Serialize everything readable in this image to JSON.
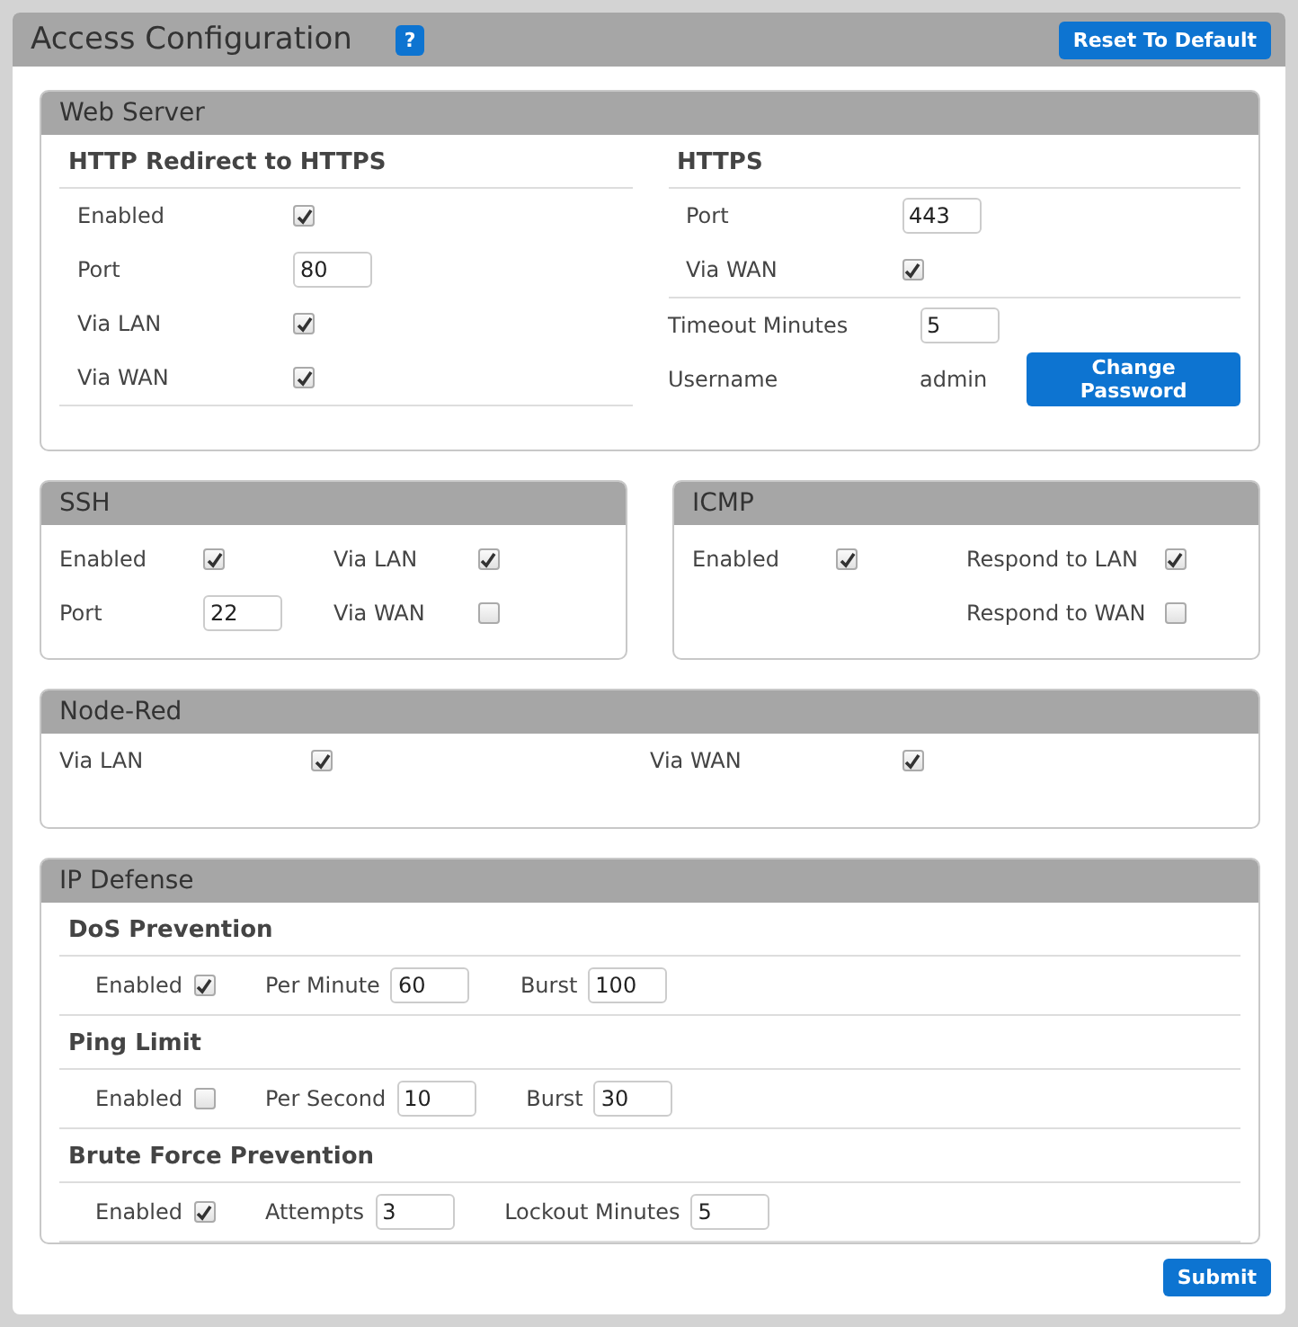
{
  "title": "Access Configuration",
  "help_button": "?",
  "reset_button": "Reset To Default",
  "web_server": {
    "title": "Web Server",
    "redirect": {
      "heading": "HTTP Redirect to HTTPS",
      "fields": [
        {
          "label": "Enabled",
          "kind": "checkbox",
          "checked": true
        },
        {
          "label": "Port",
          "kind": "input",
          "value": "80"
        },
        {
          "label": "Via LAN",
          "kind": "checkbox",
          "checked": true
        },
        {
          "label": "Via WAN",
          "kind": "checkbox",
          "checked": true
        }
      ]
    },
    "https": {
      "heading": "HTTPS",
      "fields": [
        {
          "label": "Port",
          "kind": "input",
          "value": "443"
        },
        {
          "label": "Via WAN",
          "kind": "checkbox",
          "checked": true
        }
      ],
      "settings": [
        {
          "label": "Timeout Minutes",
          "kind": "input",
          "value": "5"
        },
        {
          "label": "Username",
          "kind": "text",
          "value": "admin",
          "button": "Change Password"
        }
      ]
    }
  },
  "ssh": {
    "title": "SSH",
    "columns": [
      [
        {
          "label": "Enabled",
          "kind": "checkbox",
          "checked": true
        },
        {
          "label": "Port",
          "kind": "input",
          "value": "22"
        }
      ],
      [
        {
          "label": "Via LAN",
          "kind": "checkbox",
          "checked": true
        },
        {
          "label": "Via WAN",
          "kind": "checkbox",
          "checked": false
        }
      ]
    ]
  },
  "icmp": {
    "title": "ICMP",
    "columns": [
      [
        {
          "label": "Enabled",
          "kind": "checkbox",
          "checked": true
        }
      ],
      [
        {
          "label": "Respond to LAN",
          "kind": "checkbox",
          "checked": true
        },
        {
          "label": "Respond to WAN",
          "kind": "checkbox",
          "checked": false
        }
      ]
    ]
  },
  "node_red": {
    "title": "Node-Red",
    "columns": [
      [
        {
          "label": "Via LAN",
          "kind": "checkbox",
          "checked": true
        }
      ],
      [
        {
          "label": "Via WAN",
          "kind": "checkbox",
          "checked": true
        }
      ]
    ]
  },
  "ip_defense": {
    "title": "IP Defense",
    "groups": [
      {
        "heading": "DoS Prevention",
        "fields": [
          {
            "label": "Enabled",
            "kind": "checkbox",
            "checked": true
          },
          {
            "label": "Per Minute",
            "kind": "input",
            "value": "60"
          },
          {
            "label": "Burst",
            "kind": "input",
            "value": "100"
          }
        ]
      },
      {
        "heading": "Ping Limit",
        "fields": [
          {
            "label": "Enabled",
            "kind": "checkbox",
            "checked": false
          },
          {
            "label": "Per Second",
            "kind": "input",
            "value": "10"
          },
          {
            "label": "Burst",
            "kind": "input",
            "value": "30"
          }
        ]
      },
      {
        "heading": "Brute Force Prevention",
        "fields": [
          {
            "label": "Enabled",
            "kind": "checkbox",
            "checked": true
          },
          {
            "label": "Attempts",
            "kind": "input",
            "value": "3"
          },
          {
            "label": "Lockout Minutes",
            "kind": "input",
            "value": "5"
          }
        ]
      }
    ]
  },
  "submit_button": "Submit"
}
